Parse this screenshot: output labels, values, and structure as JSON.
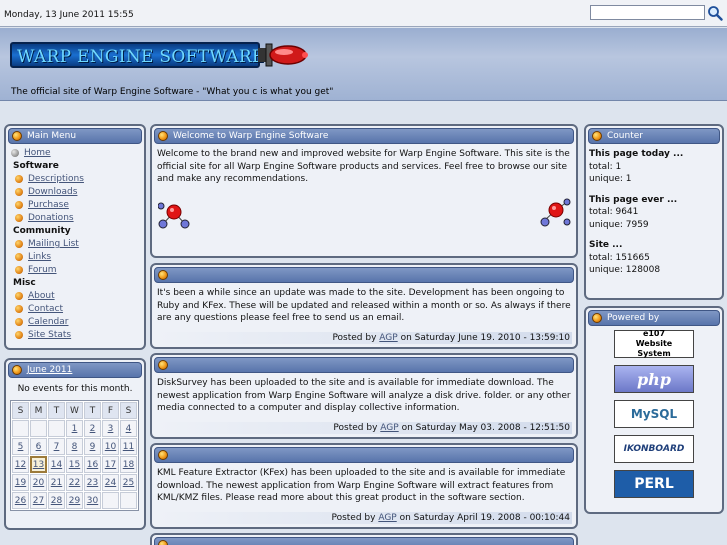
{
  "topbar": {
    "date": "Monday, 13 June 2011 15:55",
    "search_value": ""
  },
  "banner": {
    "logo_text": "WARP ENGINE SOFTWARE",
    "tagline": "The official site of Warp Engine Software - \"What you c is what you get\""
  },
  "main_menu": {
    "title": "Main Menu",
    "items": [
      {
        "label": "Home",
        "kind": "link-grey"
      },
      {
        "label": "Software",
        "kind": "heading"
      },
      {
        "label": "Descriptions",
        "kind": "sub"
      },
      {
        "label": "Downloads",
        "kind": "sub"
      },
      {
        "label": "Purchase",
        "kind": "sub"
      },
      {
        "label": "Donations",
        "kind": "sub"
      },
      {
        "label": "Community",
        "kind": "heading"
      },
      {
        "label": "Mailing List",
        "kind": "sub"
      },
      {
        "label": "Links",
        "kind": "sub"
      },
      {
        "label": "Forum",
        "kind": "sub"
      },
      {
        "label": "Misc",
        "kind": "heading"
      },
      {
        "label": "About",
        "kind": "sub"
      },
      {
        "label": "Contact",
        "kind": "sub"
      },
      {
        "label": "Calendar",
        "kind": "sub"
      },
      {
        "label": "Site Stats",
        "kind": "sub"
      }
    ]
  },
  "calendar": {
    "title": "June 2011",
    "no_events": "No events for this month.",
    "weekdays": [
      "S",
      "M",
      "T",
      "W",
      "T",
      "F",
      "S"
    ],
    "weeks": [
      [
        "",
        "",
        "",
        "1",
        "2",
        "3",
        "4"
      ],
      [
        "5",
        "6",
        "7",
        "8",
        "9",
        "10",
        "11"
      ],
      [
        "12",
        "13",
        "14",
        "15",
        "16",
        "17",
        "18"
      ],
      [
        "19",
        "20",
        "21",
        "22",
        "23",
        "24",
        "25"
      ],
      [
        "26",
        "27",
        "28",
        "29",
        "30",
        "",
        ""
      ]
    ],
    "today": "13"
  },
  "welcome": {
    "title": "Welcome to Warp Engine Software",
    "text": "Welcome to the brand new and improved website for Warp Engine Software. This site is the official site for all Warp Engine Software products and services. Feel free to browse our site and make any recommendations."
  },
  "news": [
    {
      "text": "It's been a while since an update was made to the site. Development has been ongoing to Ruby and KFex. These will be updated and released within a month or so. As always if there are any questions please feel free to send us an email.",
      "posted_prefix": "Posted by",
      "author": "AGP",
      "posted_suffix": "on Saturday June 19. 2010 - 13:59:10"
    },
    {
      "text": "DiskSurvey has been uploaded to the site and is available for immediate download. The newest application from Warp Engine Software will analyze a disk drive. folder. or any other media connected to a computer and display collective information.",
      "posted_prefix": "Posted by",
      "author": "AGP",
      "posted_suffix": "on Saturday May 03. 2008 - 12:51:50"
    },
    {
      "text": "KML Feature Extractor (KFex) has been uploaded to the site and is available for immediate download. The newest application from Warp Engine Software will extract features from KML/KMZ files. Please read more about this great product in the software section.",
      "posted_prefix": "Posted by",
      "author": "AGP",
      "posted_suffix": "on Saturday April 19. 2008 - 00:10:44"
    }
  ],
  "counter": {
    "title": "Counter",
    "today_heading": "This page today ...",
    "today_total": "total: 1",
    "today_unique": "unique: 1",
    "ever_heading": "This page ever ...",
    "ever_total": "total: 9641",
    "ever_unique": "unique: 7959",
    "site_heading": "Site ...",
    "site_total": "total: 151665",
    "site_unique": "unique: 128008"
  },
  "powered": {
    "title": "Powered by",
    "badges": [
      "e107 Website System",
      "php",
      "MySQL",
      "IKONBOARD",
      "PERL"
    ]
  },
  "colors": {
    "header_blue": "#5874ab",
    "accent_orange": "#f29a1a",
    "link": "#44557a"
  }
}
